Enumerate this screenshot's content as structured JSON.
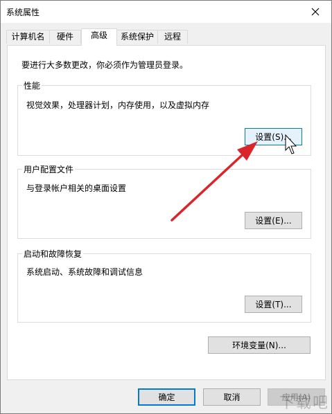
{
  "window": {
    "title": "系统属性",
    "close_symbol": "✕"
  },
  "tabs": [
    {
      "label": "计算机名",
      "active": false
    },
    {
      "label": "硬件",
      "active": false
    },
    {
      "label": "高级",
      "active": true
    },
    {
      "label": "系统保护",
      "active": false
    },
    {
      "label": "远程",
      "active": false
    }
  ],
  "advanced": {
    "admin_note": "要进行大多数更改，你必须作为管理员登录。",
    "performance": {
      "title": "性能",
      "description": "视觉效果，处理器计划，内存使用，以及虚拟内存",
      "button_label": "设置(S)..."
    },
    "user_profiles": {
      "title": "用户配置文件",
      "description": "与登录帐户相关的桌面设置",
      "button_label": "设置(E)..."
    },
    "startup_recovery": {
      "title": "启动和故障恢复",
      "description": "系统启动、系统故障和调试信息",
      "button_label": "设置(T)..."
    },
    "env_button_label": "环境变量(N)..."
  },
  "footer": {
    "ok_label": "确定",
    "cancel_label": "取消",
    "apply_label": "应用(A)"
  },
  "annotation": {
    "arrow_color": "#d9262a"
  },
  "watermark": {
    "text": "下载吧"
  }
}
